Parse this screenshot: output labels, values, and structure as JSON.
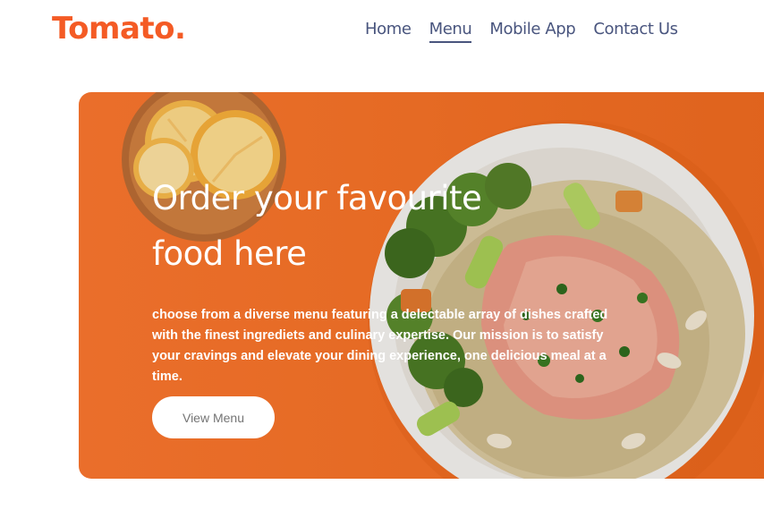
{
  "navbar": {
    "logo": "Tomato.",
    "links": [
      "Home",
      "Menu",
      "Mobile App",
      "Contact Us"
    ],
    "active": "Menu"
  },
  "hero": {
    "title_line1": "Order your favourite",
    "title_line2": "food here",
    "description": "choose from a diverse menu featuring a delectable array of dishes crafted with the finest ingrediets and culinary expertise. Our mission is to satisfy your cravings and elevate your dining experience, one delicious meal at a time.",
    "button_label": "View Menu"
  },
  "colors": {
    "brand": "#f45b25",
    "nav_text": "#49557e",
    "hero_bg": "#f57228"
  }
}
